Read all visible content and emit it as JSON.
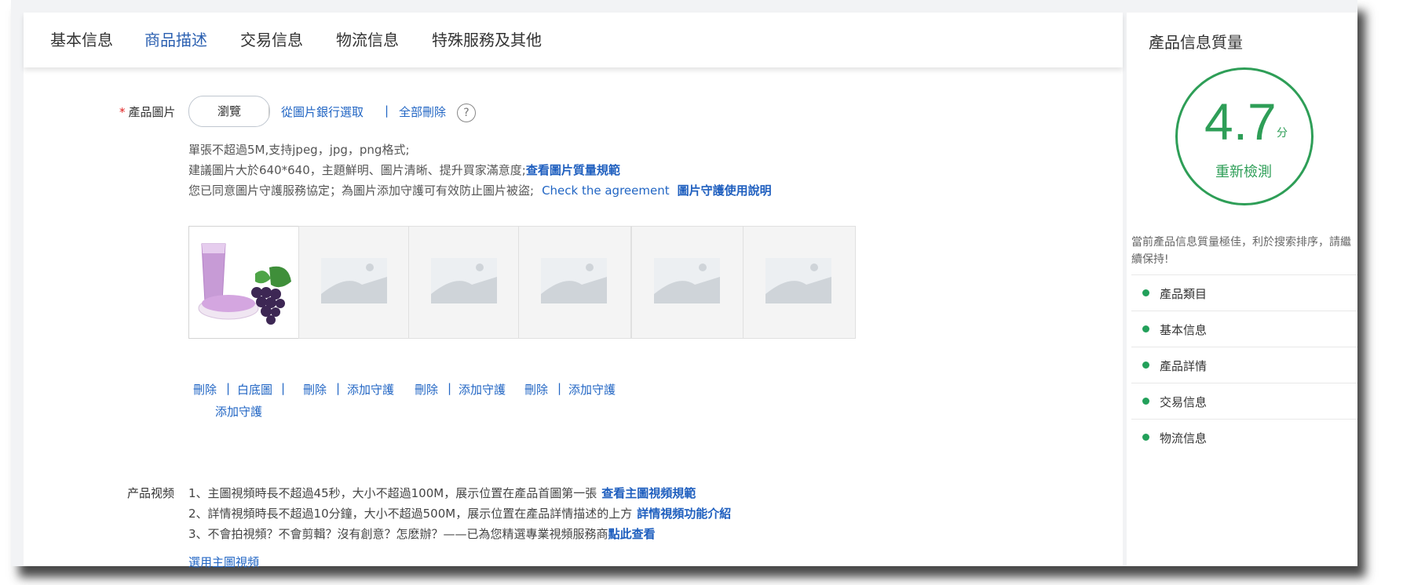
{
  "tabs": [
    "基本信息",
    "商品描述",
    "交易信息",
    "物流信息",
    "特殊服務及其他"
  ],
  "active_tab": "商品描述",
  "product_image": {
    "label": "產品圖片",
    "required_mark": "*",
    "browse_label": "瀏覽",
    "select_from_bank": "從圖片銀行選取",
    "separator": "|",
    "delete_all": "全部刪除",
    "help": "?",
    "note1": "單張不超過5M,支持jpeg，jpg，png格式;",
    "note2_text": "建議圖片大於640*640，主題鮮明、圖片清晰、提升買家滿意度;",
    "note2_link": "查看圖片質量規範",
    "note3_text": "您已同意圖片守護服務協定；為圖片添加守護可有效防止圖片被盜;",
    "note3_link1": "Check the agreement",
    "note3_link2": "圖片守護使用說明",
    "thumbnails": [
      {
        "kind": "product-photo"
      },
      {
        "kind": "placeholder"
      },
      {
        "kind": "placeholder"
      },
      {
        "kind": "placeholder"
      },
      {
        "kind": "placeholder"
      },
      {
        "kind": "placeholder"
      }
    ],
    "actions": {
      "delete": "刪除",
      "white_bg": "白底圖",
      "add_protect": "添加守護",
      "sep": "|"
    }
  },
  "video": {
    "label": "产品视频",
    "rule1_text": "1、主圖視頻時長不超過45秒，大小不超過100M，展示位置在產品首圖第一張",
    "rule1_link": "查看主圖視頻規範",
    "rule2_text": "2、詳情視頻時長不超過10分鐘，大小不超過500M，展示位置在產品詳情描述的上方",
    "rule2_link": "詳情視頻功能介紹",
    "rule3_text": "3、不會拍視頻？不會剪輯？沒有創意？怎麽辦？——已為您精選專業視頻服務商",
    "rule3_link": "點此查看",
    "select_main": "選用主圖視頻"
  },
  "quality": {
    "title": "產品信息質量",
    "score": "4.7",
    "unit": "分",
    "recheck": "重新檢測",
    "message": "當前產品信息質量極佳，利於搜索排序，請繼續保持!",
    "items": [
      "產品類目",
      "基本信息",
      "產品詳情",
      "交易信息",
      "物流信息"
    ],
    "status_color": "#22a05a"
  }
}
